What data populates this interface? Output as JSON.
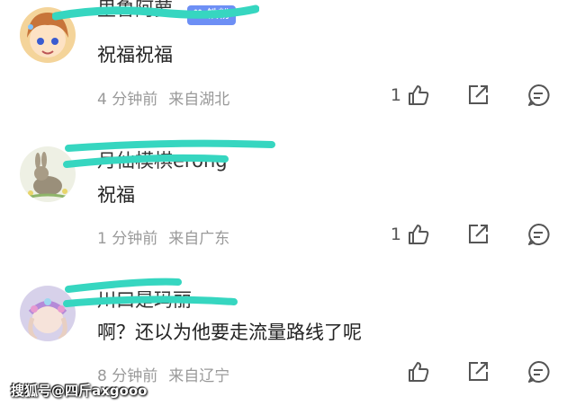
{
  "comments": [
    {
      "username": "里鲁阿萝",
      "badge": "♥ 铁粉",
      "content": "祝福祝福",
      "time": "4 分钟前",
      "location": "来自湖北",
      "like_count": "1",
      "avatar": "anime-girl-avatar"
    },
    {
      "username": "月仙模棋erong",
      "content": "祝福",
      "time": "1 分钟前",
      "location": "来自广东",
      "like_count": "1",
      "avatar": "rabbit-avatar"
    },
    {
      "username": "川口是玛丽",
      "content": "啊？还以为他要走流量路线了呢",
      "time": "8 分钟前",
      "location": "来自辽宁",
      "like_count": "",
      "avatar": "girl-flower-crown-avatar"
    }
  ],
  "icons": [
    "thumbs-up-icon",
    "share-icon",
    "reply-icon"
  ],
  "colors": {
    "scribble": "#36d6c0",
    "badge": "#6d8ff5",
    "meta": "#9a9a9a"
  },
  "watermark": "搜狐号@四斤axgooo"
}
